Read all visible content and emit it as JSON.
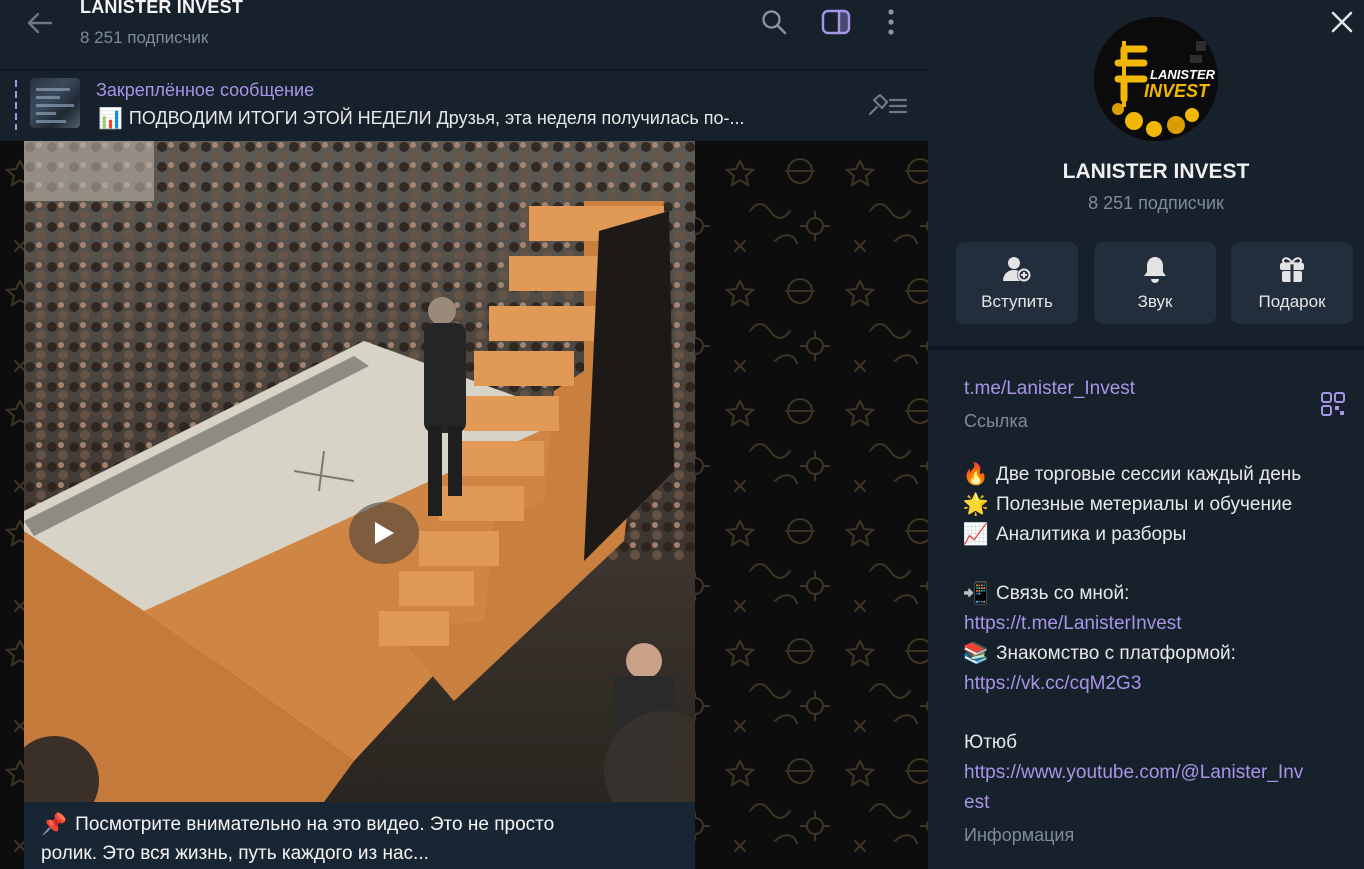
{
  "header": {
    "title": "LANISTER INVEST",
    "subscribers": "8 251 подписчик"
  },
  "pinned": {
    "label": "Закреплённое сообщение",
    "emoji": "📊",
    "text": "ПОДВОДИМ ИТОГИ ЭТОЙ НЕДЕЛИ  Друзья, эта неделя получилась по-..."
  },
  "message": {
    "emoji": "📌",
    "line1": "Посмотрите внимательно на это видео. Это не просто",
    "line2": "ролик. Это вся жизнь, путь каждого из нас..."
  },
  "panel": {
    "logo_line1": "LANISTER",
    "logo_line2": "INVEST",
    "name": "LANISTER INVEST",
    "subscribers": "8 251 подписчик",
    "actions": [
      {
        "label": "Вступить",
        "icon": "add-user-icon"
      },
      {
        "label": "Звук",
        "icon": "bell-icon"
      },
      {
        "label": "Подарок",
        "icon": "gift-icon"
      }
    ],
    "link": "t.me/Lanister_Invest",
    "link_caption": "Ссылка",
    "bullets": [
      {
        "emoji": "🔥",
        "text": "Две торговые сессии каждый день"
      },
      {
        "emoji": "🌟",
        "text": "Полезные метериалы и обучение"
      },
      {
        "emoji": "📈",
        "text": "Аналитика и разборы"
      }
    ],
    "contact_emoji": "📲",
    "contact_label": "Связь со мной:",
    "contact_url": "https://t.me/LanisterInvest",
    "platform_emoji": "📚",
    "platform_label": "Знакомство с платформой:",
    "platform_url": "https://vk.cc/cqM2G3",
    "youtube_label": "Ютюб",
    "youtube_url_line1": "https://www.youtube.com/@Lanister_Inv",
    "youtube_url_line2": "est",
    "info_caption": "Информация"
  },
  "colors": {
    "accent": "#a695e7",
    "panel_bg": "#17212b",
    "button_bg": "#232e3c",
    "muted": "#7f8b96"
  }
}
